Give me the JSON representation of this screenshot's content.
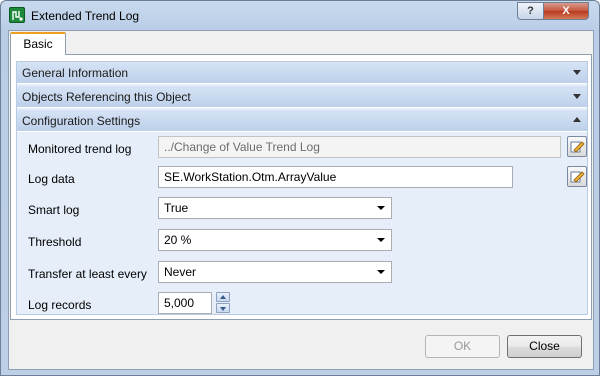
{
  "window": {
    "title": "Extended Trend Log"
  },
  "caption_buttons": {
    "help": "?",
    "close": "X"
  },
  "tabs": [
    {
      "label": "Basic"
    }
  ],
  "sections": [
    {
      "label": "General Information",
      "expanded": false
    },
    {
      "label": "Objects Referencing this Object",
      "expanded": false
    },
    {
      "label": "Configuration Settings",
      "expanded": true
    }
  ],
  "fields": {
    "monitored_trend_log": {
      "label": "Monitored trend log",
      "value": "../Change of Value Trend Log",
      "disabled": true
    },
    "log_data": {
      "label": "Log data",
      "value": "SE.WorkStation.Otm.ArrayValue"
    },
    "smart_log": {
      "label": "Smart log",
      "value": "True"
    },
    "threshold": {
      "label": "Threshold",
      "value": "20 %"
    },
    "transfer": {
      "label": "Transfer at least every",
      "value": "Never"
    },
    "log_records": {
      "label": "Log records",
      "value": "5,000"
    }
  },
  "footer": {
    "ok_label": "OK",
    "close_label": "Close"
  }
}
